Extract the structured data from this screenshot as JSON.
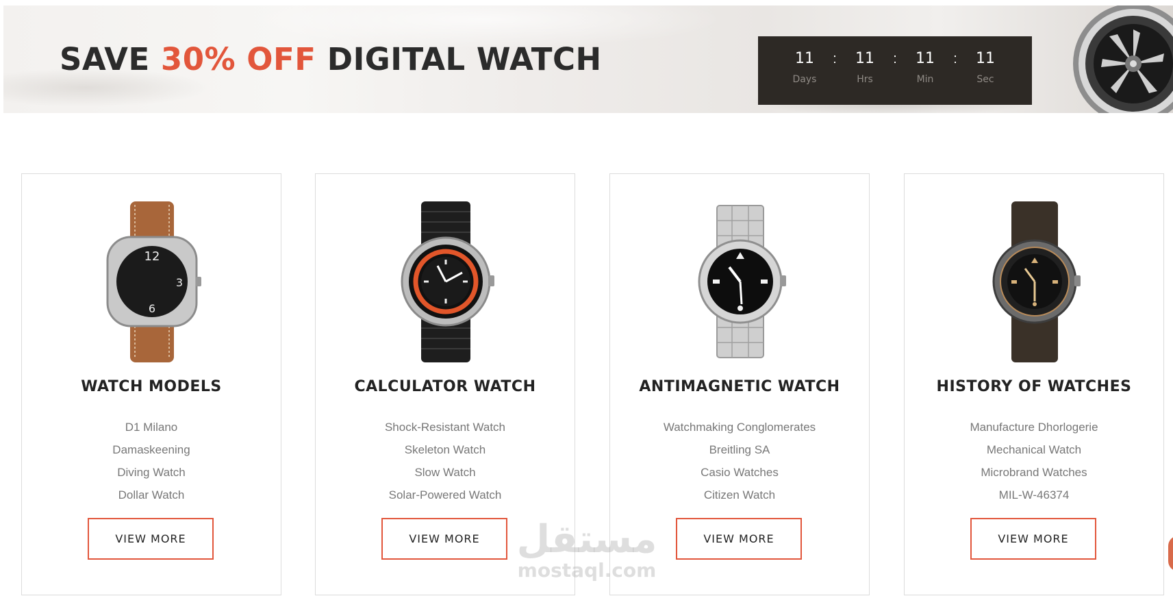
{
  "banner": {
    "title_prefix": "SAVE ",
    "title_accent": "30% OFF",
    "title_suffix": " DIGITAL WATCH",
    "accent_color": "#e2563b",
    "countdown": [
      {
        "value": "11",
        "label": "Days"
      },
      {
        "value": "11",
        "label": "Hrs"
      },
      {
        "value": "11",
        "label": "Min"
      },
      {
        "value": "11",
        "label": "Sec"
      }
    ],
    "separator": ":"
  },
  "cards": [
    {
      "title": "WATCH MODELS",
      "image_icon": "brown-leather-strap-watch",
      "items": [
        "D1 Milano",
        "Damaskeening",
        "Diving Watch",
        "Dollar Watch"
      ],
      "button": "VIEW MORE"
    },
    {
      "title": "CALCULATOR WATCH",
      "image_icon": "black-orange-diver-watch",
      "items": [
        "Shock-Resistant Watch",
        "Skeleton Watch",
        "Slow Watch",
        "Solar-Powered Watch"
      ],
      "button": "VIEW MORE"
    },
    {
      "title": "ANTIMAGNETIC WATCH",
      "image_icon": "steel-bracelet-watch",
      "items": [
        "Watchmaking Conglomerates",
        "Breitling SA",
        "Casio Watches",
        "Citizen Watch"
      ],
      "button": "VIEW MORE"
    },
    {
      "title": "HISTORY OF WATCHES",
      "image_icon": "dark-fabric-strap-watch",
      "items": [
        "Manufacture Dhorlogerie",
        "Mechanical Watch",
        "Microbrand Watches",
        "MIL-W-46374"
      ],
      "button": "VIEW MORE"
    }
  ],
  "watermark": {
    "arabic": "مستقل",
    "latin": "mostaql.com"
  }
}
